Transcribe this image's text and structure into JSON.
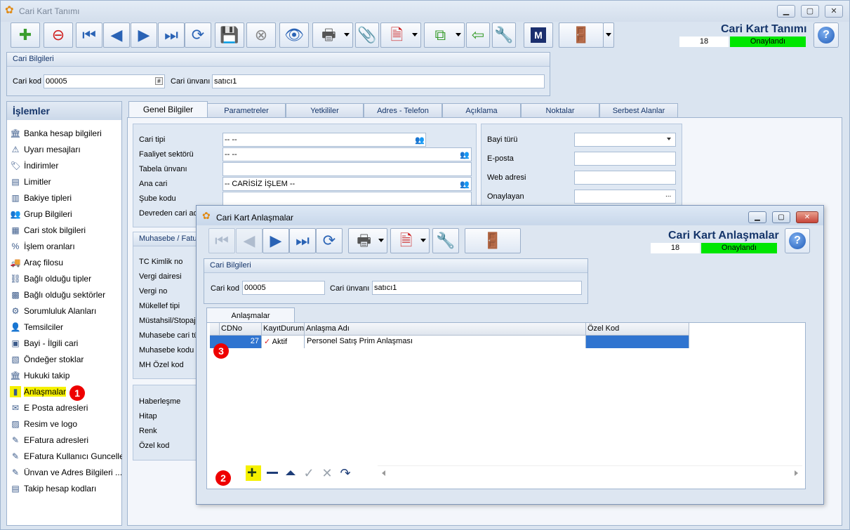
{
  "window": {
    "title": "Cari Kart Tanımı"
  },
  "header": {
    "title": "Cari Kart Tanımı",
    "record_no": "18",
    "status": "Onaylandı"
  },
  "cari_bilgileri": {
    "heading": "Cari Bilgileri",
    "kod_label": "Cari kod",
    "kod_value": "00005",
    "unvan_label": "Cari ünvanı",
    "unvan_value": "satıcı1"
  },
  "islemler": {
    "title": "İşlemler",
    "items": [
      {
        "label": "Banka hesap bilgileri",
        "icon": "bank-icon"
      },
      {
        "label": "Uyarı mesajları",
        "icon": "warning-icon"
      },
      {
        "label": "İndirimler",
        "icon": "discount-icon"
      },
      {
        "label": "Limitler",
        "icon": "limit-icon"
      },
      {
        "label": "Bakiye tipleri",
        "icon": "balance-icon"
      },
      {
        "label": "Grup Bilgileri",
        "icon": "group-icon"
      },
      {
        "label": "Cari stok bilgileri",
        "icon": "stock-icon"
      },
      {
        "label": "İşlem oranları",
        "icon": "percent-icon"
      },
      {
        "label": "Araç filosu",
        "icon": "vehicle-icon"
      },
      {
        "label": "Bağlı olduğu tipler",
        "icon": "link-icon"
      },
      {
        "label": "Bağlı olduğu sektörler",
        "icon": "sector-icon"
      },
      {
        "label": "Sorumluluk Alanları",
        "icon": "responsibility-icon"
      },
      {
        "label": "Temsilciler",
        "icon": "person-icon"
      },
      {
        "label": "Bayi - İlgili cari",
        "icon": "dealer-icon"
      },
      {
        "label": "Öndeğer stoklar",
        "icon": "default-stock-icon"
      },
      {
        "label": "Hukuki takip",
        "icon": "court-icon"
      },
      {
        "label": "Anlaşmalar",
        "icon": "agreement-icon"
      },
      {
        "label": "E Posta adresleri",
        "icon": "mail-icon"
      },
      {
        "label": "Resim ve logo",
        "icon": "image-icon"
      },
      {
        "label": "EFatura adresleri",
        "icon": "einvoice-icon"
      },
      {
        "label": "EFatura Kullanıcı Guncelle",
        "icon": "einvoice-user-icon"
      },
      {
        "label": "Ünvan ve Adres Bilgileri ...",
        "icon": "address-icon"
      },
      {
        "label": "Takip hesap kodları",
        "icon": "tracking-icon"
      }
    ]
  },
  "tabs": [
    "Genel Bilgiler",
    "Parametreler",
    "Yetkililer",
    "Adres - Telefon",
    "Açıklama",
    "Noktalar",
    "Serbest Alanlar"
  ],
  "genel": {
    "cari_tipi_label": "Cari tipi",
    "cari_tipi_value": "-- --",
    "faaliyet_label": "Faaliyet sektörü",
    "faaliyet_value": "-- --",
    "tabela_label": "Tabela ünvanı",
    "ana_cari_label": "Ana cari",
    "ana_cari_value": "-- CARİSİZ İŞLEM --",
    "sube_label": "Şube kodu",
    "devreden_label": "Devreden cari ad",
    "muhasebe_heading": "Muhasebe / Fatu",
    "tc_label": "TC Kimlik no",
    "vergi_dairesi_label": "Vergi dairesi",
    "vergi_no_label": "Vergi no",
    "mukellef_label": "Mükellef tipi",
    "mustahsil_label": "Müstahsil/Stopaj",
    "muh_cari_label": "Muhasebe cari tü",
    "muh_kodu_label": "Muhasebe kodu b",
    "mh_ozel_label": "MH Özel kod",
    "haberlesme_label": "Haberleşme",
    "hitap_label": "Hitap",
    "renk_label": "Renk",
    "ozel_kod_label": "Özel kod",
    "bayi_turu_label": "Bayi türü",
    "eposta_label": "E-posta",
    "web_label": "Web adresi",
    "onaylayan_label": "Onaylayan",
    "ellipsis": "..."
  },
  "dialog": {
    "window_title": "Cari Kart Anlaşmalar",
    "title": "Cari Kart Anlaşmalar",
    "record_no": "18",
    "status": "Onaylandı",
    "cari_heading": "Cari Bilgileri",
    "kod_label": "Cari kod",
    "kod_value": "00005",
    "unvan_label": "Cari ünvanı",
    "unvan_value": "satıcı1",
    "tab": "Anlaşmalar",
    "columns": [
      "CDNo",
      "KayıtDurumu",
      "Anlaşma Adı",
      "Özel Kod"
    ],
    "rows": [
      {
        "cdno": "27",
        "durum": "Aktif",
        "ad": "Personel Satış Prim Anlaşması",
        "ozel": ""
      }
    ]
  },
  "badges": [
    "1",
    "2",
    "3"
  ],
  "colors": {
    "accent": "#15356a",
    "status_ok": "#00e600",
    "selected_row": "#2f74d0",
    "highlight": "#f5f000",
    "badge": "#e00000"
  }
}
